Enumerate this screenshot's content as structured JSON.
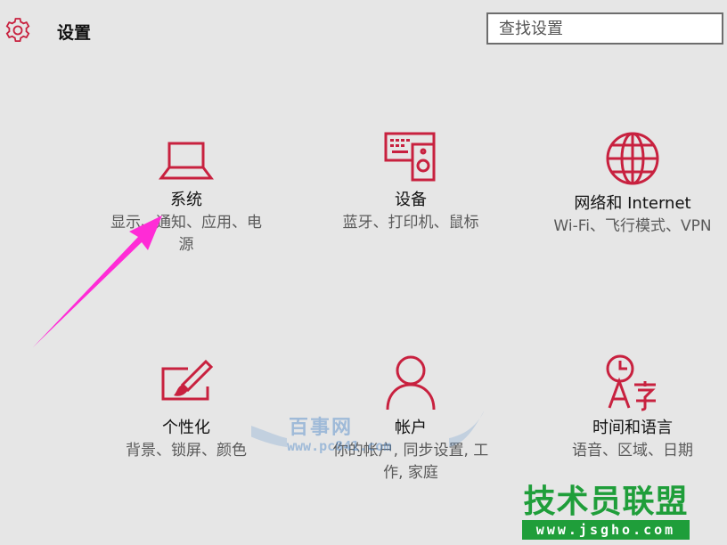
{
  "header": {
    "title": "设置",
    "icon": "gear-icon"
  },
  "search": {
    "placeholder": "查找设置"
  },
  "accent_color": "#c8213f",
  "tiles": [
    {
      "title": "系统",
      "desc_lines": [
        "显示、通知、应用、电",
        "源"
      ],
      "icon": "laptop-icon"
    },
    {
      "title": "设备",
      "desc_lines": [
        "蓝牙、打印机、鼠标"
      ],
      "icon": "devices-icon"
    },
    {
      "title": "网络和 Internet",
      "desc_lines": [
        "Wi-Fi、飞行模式、VPN"
      ],
      "icon": "globe-icon"
    },
    {
      "title": "个性化",
      "desc_lines": [
        "背景、锁屏、颜色"
      ],
      "icon": "personalization-icon"
    },
    {
      "title": "帐户",
      "desc_lines": [
        "你的帐户, 同步设置, 工",
        "作, 家庭"
      ],
      "icon": "person-icon"
    },
    {
      "title": "时间和语言",
      "desc_lines": [
        "语音、区域、日期"
      ],
      "icon": "time-language-icon"
    }
  ],
  "overlays": {
    "watermark_main": "百事网",
    "watermark_sub": "www.pc841.com",
    "logo_main": "技术员联盟",
    "logo_sub": "www.jsgho.com",
    "arrow_color": "#ff2bd6"
  }
}
